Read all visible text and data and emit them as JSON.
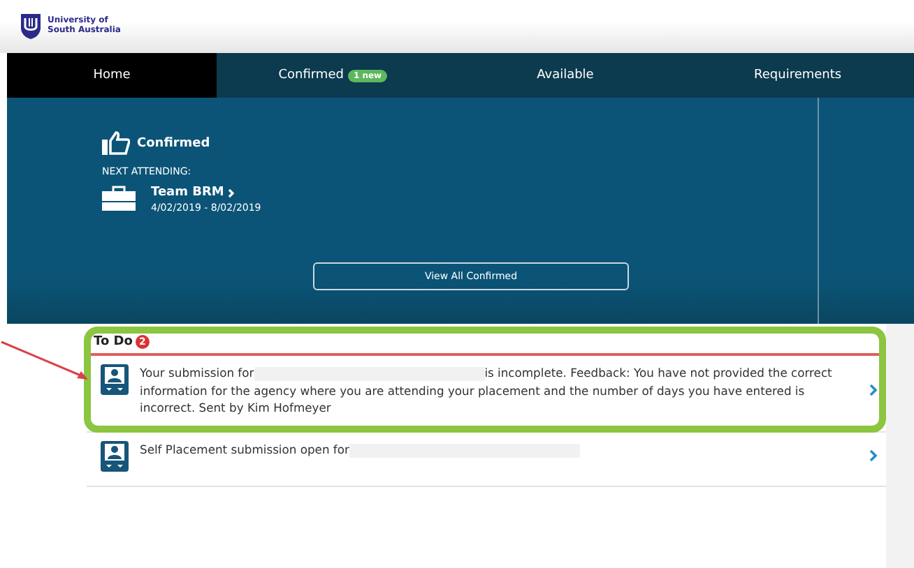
{
  "header": {
    "logo_text": "University of\nSouth Australia"
  },
  "tabs": [
    {
      "label": "Home",
      "selected": true
    },
    {
      "label": "Confirmed",
      "selected": false,
      "badge": "1 new"
    },
    {
      "label": "Available",
      "selected": false
    },
    {
      "label": "Requirements",
      "selected": false
    }
  ],
  "confirmed_panel": {
    "title": "Confirmed",
    "next_label": "NEXT ATTENDING:",
    "placement": "Team BRM",
    "dates": "4/02/2019 - 8/02/2019",
    "button": "View All Confirmed"
  },
  "todo": {
    "title": "To Do",
    "count": "2",
    "items": [
      {
        "text_before": "Your submission for",
        "redacted": true,
        "text_after": "is incomplete. Feedback: You have not provided the correct information for the agency where you are attending your placement and the number of days you have entered is incorrect. Sent by Kim Hofmeyer"
      },
      {
        "text_before": "Self Placement submission open for",
        "redacted": true
      }
    ]
  }
}
